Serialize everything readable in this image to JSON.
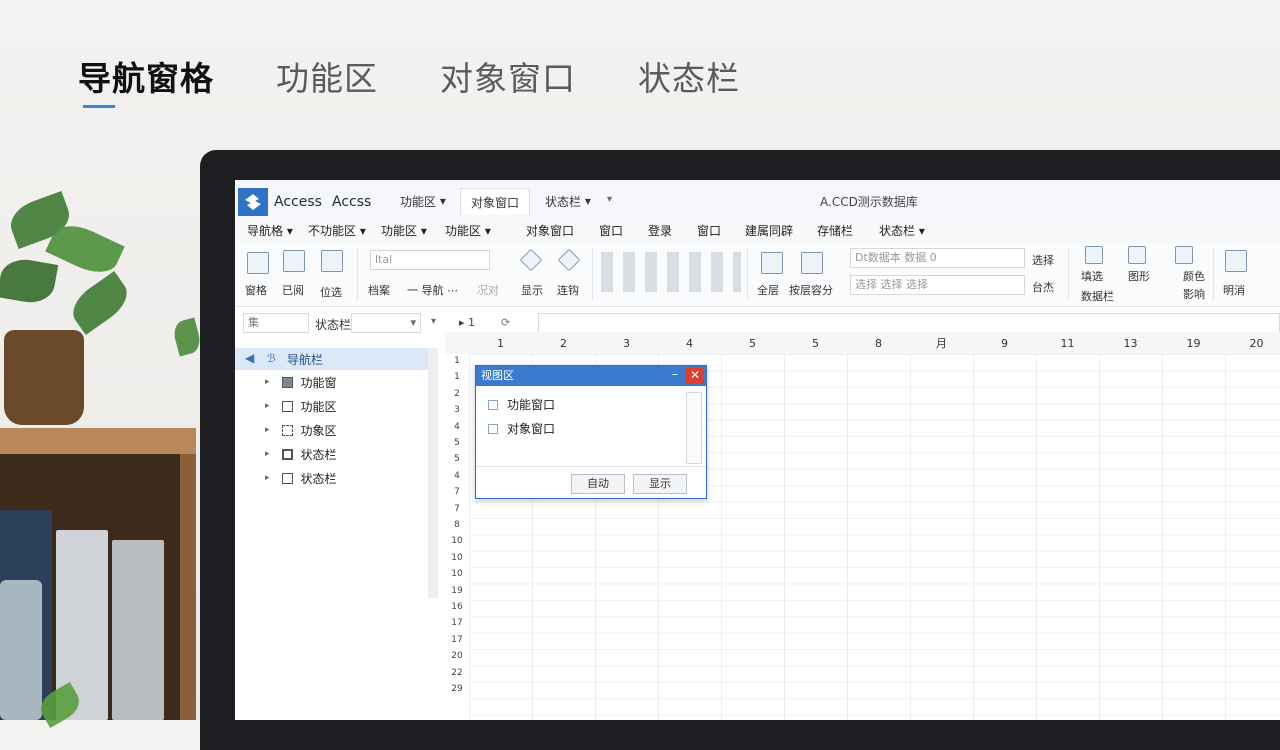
{
  "slide_tabs": [
    {
      "label": "导航窗格",
      "active": true
    },
    {
      "label": "功能区",
      "active": false
    },
    {
      "label": "对象窗口",
      "active": false
    },
    {
      "label": "状态栏",
      "active": false
    }
  ],
  "app": {
    "name_1": "Access",
    "name_2": "Accss",
    "title_tabs": [
      "功能区",
      "对象窗口",
      "状态栏"
    ],
    "window_title": "A.CCD测示数据库",
    "accent_color": "#2e73c8"
  },
  "menu": {
    "items": [
      "导航格",
      "不功能区",
      "功能区",
      "功能区",
      "对象窗口",
      "窗口",
      "登录",
      "窗口",
      "建属同辟",
      "存储栏",
      "状态栏"
    ]
  },
  "ribbon": {
    "group1": [
      "窗格",
      "已阅",
      "位选"
    ],
    "font_field": "ltal",
    "group2": [
      "档案",
      "导航",
      "况对",
      "显示",
      "连钩"
    ],
    "group3": [
      "全层",
      "按层容分"
    ],
    "combo1": "Dt数据本 数据 0",
    "combo2": "选择 选择 选择",
    "side_labels": [
      "选择",
      "台杰"
    ],
    "group4": [
      "填选",
      "数据栏",
      "图形",
      "颜色",
      "影响",
      "明消"
    ]
  },
  "filter_bar": {
    "field1": "集",
    "label": "状态栏",
    "pager": "1"
  },
  "nav": {
    "header": "导航栏",
    "items": [
      "功能窗",
      "功能区",
      "功象区",
      "状态栏",
      "状态栏"
    ]
  },
  "grid": {
    "columns": [
      "1",
      "2",
      "3",
      "4",
      "5",
      "5",
      "8",
      "月",
      "9",
      "11",
      "13",
      "19",
      "20"
    ],
    "rows": [
      "1",
      "1",
      "2",
      "3",
      "4",
      "5",
      "5",
      "4",
      "7",
      "7",
      "8",
      "10",
      "10",
      "10",
      "19",
      "16",
      "17",
      "17",
      "20",
      "22",
      "29"
    ]
  },
  "dialog": {
    "title": "视图区",
    "items": [
      "功能窗口",
      "对象窗口"
    ],
    "cancel_label": "自动",
    "ok_label": "显示",
    "close_glyph": "✕",
    "minimize_glyph": "–"
  }
}
